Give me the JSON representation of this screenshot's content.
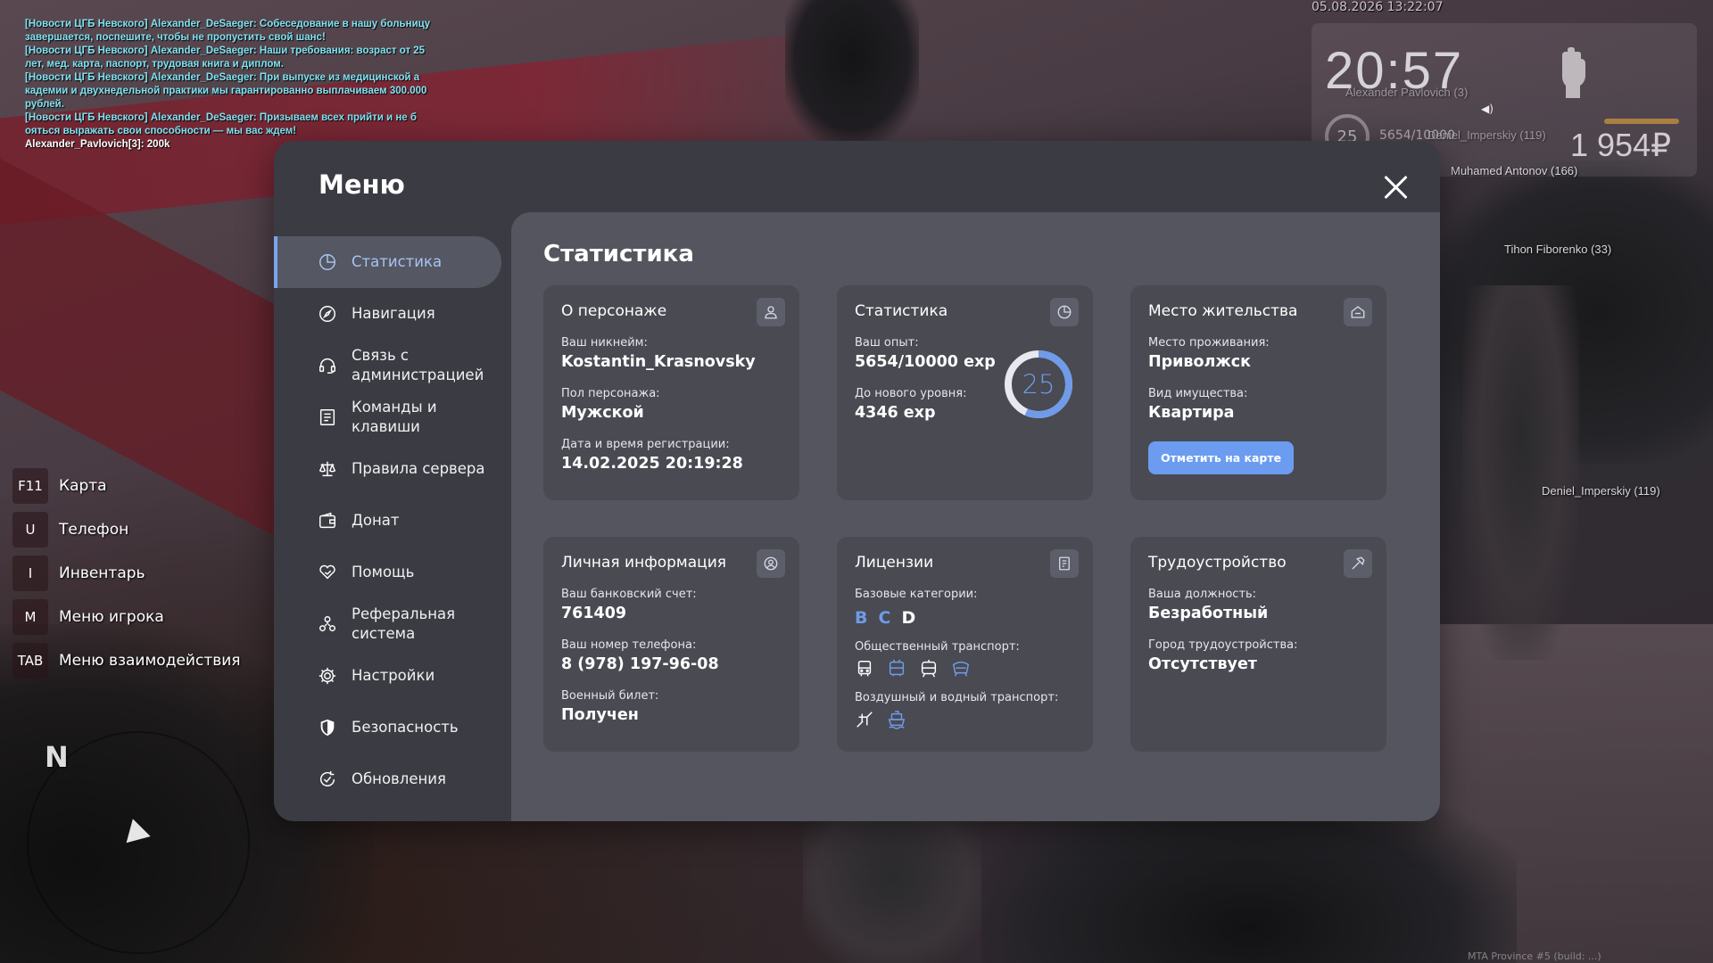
{
  "chat": [
    {
      "text": "[Новости ЦГБ Невского] Alexander_DeSaeger: Собеседование в нашу больницу",
      "color": "cyan"
    },
    {
      "text": " завершается, поспешите, чтобы не пропустить свой шанс!",
      "color": "cyan"
    },
    {
      "text": "[Новости ЦГБ Невского] Alexander_DeSaeger: Наши требования: возраст от 25",
      "color": "cyan"
    },
    {
      "text": "лет, мед. карта, паспорт, трудовая книга и диплом.",
      "color": "cyan"
    },
    {
      "text": "[Новости ЦГБ Невского] Alexander_DeSaeger: При выпуске из медицинской а",
      "color": "cyan"
    },
    {
      "text": "кадемии и двухнедельной практики мы гарантированно выплачиваем 300.000",
      "color": "cyan"
    },
    {
      "text": "рублей.",
      "color": "cyan"
    },
    {
      "text": "[Новости ЦГБ Невского] Alexander_DeSaeger: Призываем всех прийти и не б",
      "color": "cyan"
    },
    {
      "text": "ояться выражать свои способности — мы вас ждем!",
      "color": "cyan"
    },
    {
      "text": "Alexander_Pavlovich[3]: 200k",
      "color": "white"
    }
  ],
  "hud": {
    "datetime": "05.08.2026 13:22:07",
    "time": "20:57",
    "level": "25",
    "exp": "5654/10000",
    "money": "1 954₽"
  },
  "nametags": {
    "alexander": "Alexander Pavlovich (3)",
    "deniel_top": "Deniel_Imperskiy (119)",
    "muhamed": "Muhamed Antonov (166)",
    "tihon": "Tihon Fiborenko (33)",
    "deniel": "Deniel_Imperskiy (119)"
  },
  "hotkeys": [
    {
      "key": "F11",
      "label": "Карта"
    },
    {
      "key": "U",
      "label": "Телефон"
    },
    {
      "key": "I",
      "label": "Инвентарь"
    },
    {
      "key": "M",
      "label": "Меню игрока"
    },
    {
      "key": "TAB",
      "label": "Меню взаимодействия"
    }
  ],
  "compass": {
    "n": "N"
  },
  "version": "MTA Province #5 (build: ...)",
  "menu": {
    "title": "Меню",
    "sidebar": [
      {
        "label": "Статистика",
        "icon": "chart-pie-icon"
      },
      {
        "label": "Навигация",
        "icon": "compass-icon"
      },
      {
        "label": "Связь с администрацией",
        "icon": "headset-icon"
      },
      {
        "label": "Команды и клавиши",
        "icon": "document-icon"
      },
      {
        "label": "Правила сервера",
        "icon": "scales-icon"
      },
      {
        "label": "Донат",
        "icon": "wallet-icon"
      },
      {
        "label": "Помощь",
        "icon": "helping-hand-icon"
      },
      {
        "label": "Реферальная система",
        "icon": "people-icon"
      },
      {
        "label": "Настройки",
        "icon": "gear-icon"
      },
      {
        "label": "Безопасность",
        "icon": "shield-icon"
      },
      {
        "label": "Обновления",
        "icon": "refresh-check-icon"
      }
    ],
    "content_title": "Статистика"
  },
  "cards": {
    "character": {
      "title": "О персонаже",
      "nick_label": "Ваш никнейм:",
      "nick": "Kostantin_Krasnovsky",
      "gender_label": "Пол персонажа:",
      "gender": "Мужской",
      "reg_label": "Дата и время регистрации:",
      "reg": "14.02.2025 20:19:28"
    },
    "stats": {
      "title": "Статистика",
      "exp_label": "Ваш опыт:",
      "exp": "5654/10000 exp",
      "next_label": "До нового уровня:",
      "next": "4346 exp",
      "level": "25",
      "progress": 0.5654
    },
    "residence": {
      "title": "Место жительства",
      "place_label": "Место проживания:",
      "place": "Приволжск",
      "type_label": "Вид имущества:",
      "type": "Квартира",
      "button": "Отметить на карте"
    },
    "personal": {
      "title": "Личная информация",
      "bank_label": "Ваш банковский счет:",
      "bank": "761409",
      "phone_label": "Ваш номер телефона:",
      "phone": "8 (978) 197-96-08",
      "military_label": "Военный билет:",
      "military": "Получен"
    },
    "licenses": {
      "title": "Лицензии",
      "base_label": "Базовые категории:",
      "categories": [
        {
          "name": "B",
          "owned": true
        },
        {
          "name": "C",
          "owned": true
        },
        {
          "name": "D",
          "owned": false
        }
      ],
      "public_label": "Общественный транспорт:",
      "air_label": "Воздушный и водный транспорт:"
    },
    "job": {
      "title": "Трудоустройство",
      "position_label": "Ваша должность:",
      "position": "Безработный",
      "city_label": "Город трудоустройства:",
      "city": "Отсутствует"
    }
  },
  "colors": {
    "accent": "#6f9be8",
    "panel": "#3b3b43",
    "content": "#54555e",
    "card": "#494a52"
  }
}
